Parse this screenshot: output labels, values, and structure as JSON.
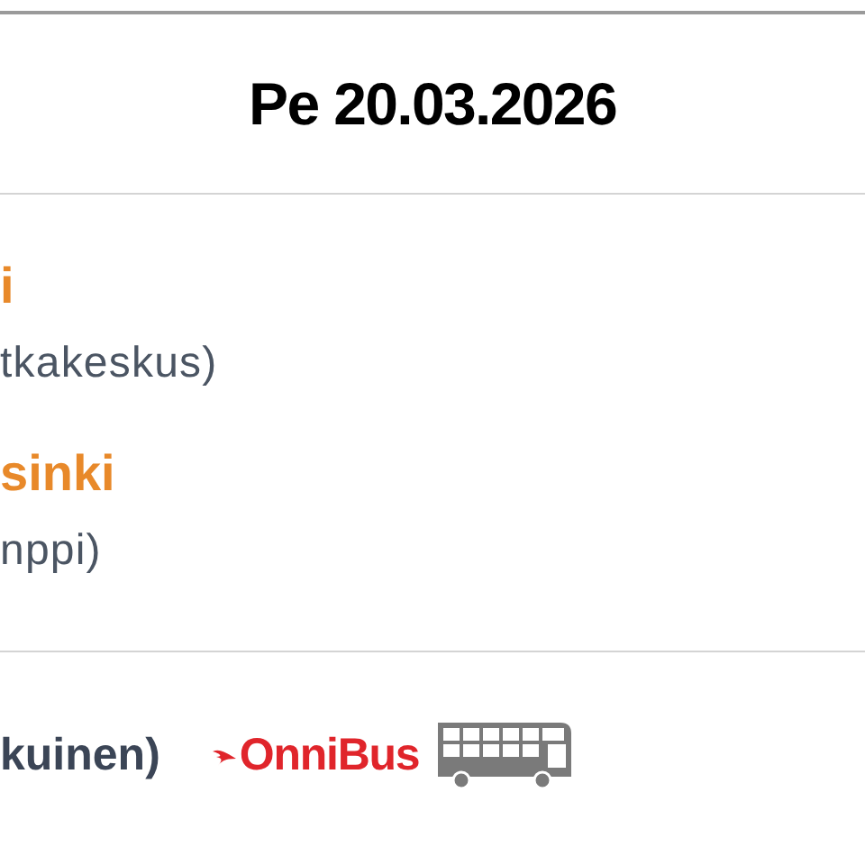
{
  "header": {
    "date": "Pe 20.03.2026"
  },
  "stops": [
    {
      "city": "i",
      "station": "tkakeskus)"
    },
    {
      "city": "sinki",
      "station": "nppi)"
    }
  ],
  "operator": {
    "bus_type": "kuinen)",
    "brand": "OnniBus"
  }
}
